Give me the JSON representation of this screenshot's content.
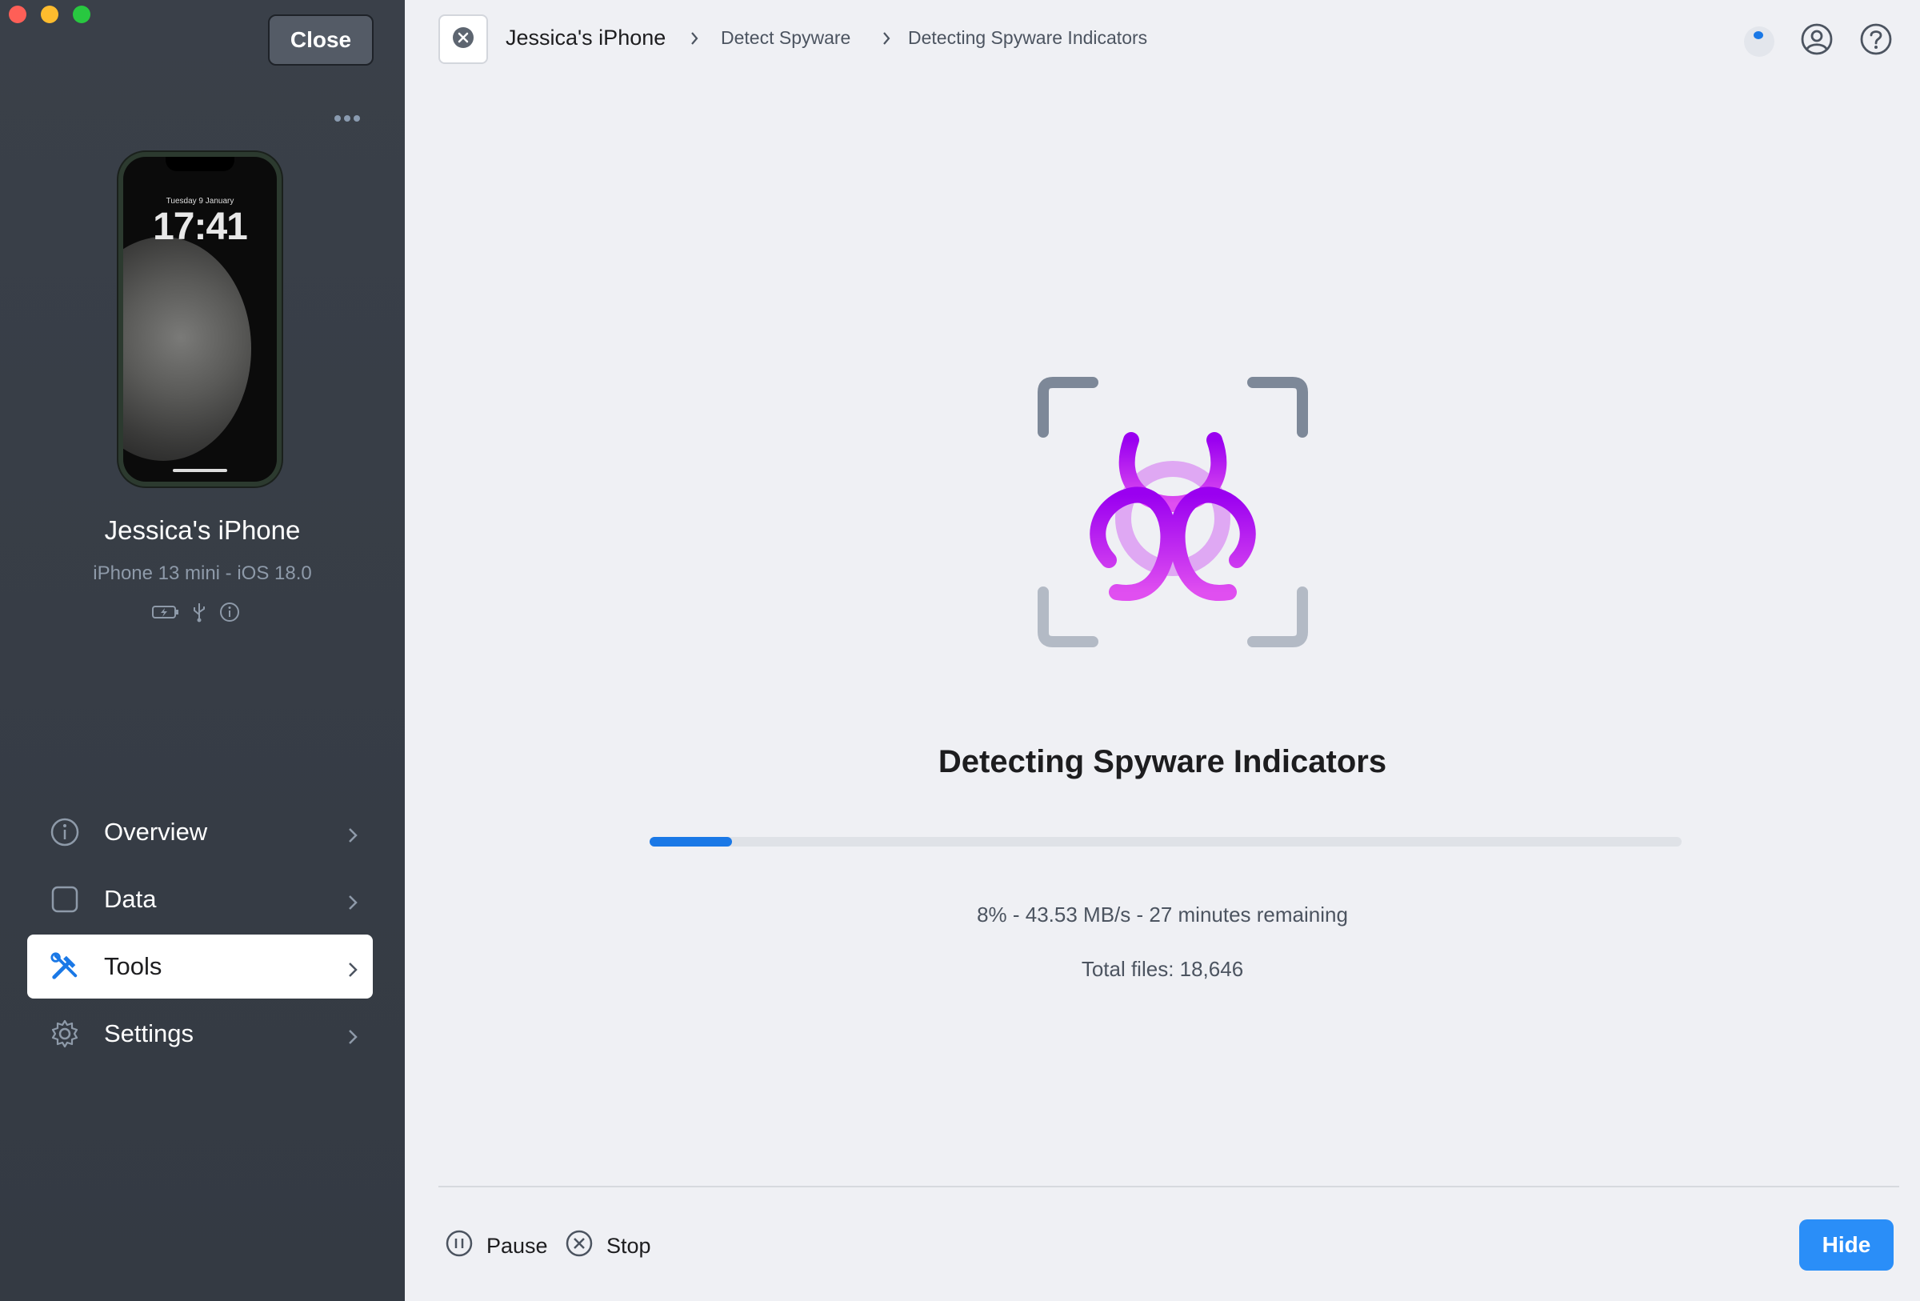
{
  "window": {
    "close_label": "Close"
  },
  "device": {
    "lock_date": "Tuesday 9 January",
    "lock_time": "17:41",
    "name": "Jessica's iPhone",
    "model": "iPhone 13 mini - iOS 18.0"
  },
  "sidebar": {
    "items": [
      {
        "label": "Overview",
        "icon": "info-icon"
      },
      {
        "label": "Data",
        "icon": "square-icon"
      },
      {
        "label": "Tools",
        "icon": "tools-icon",
        "active": true
      },
      {
        "label": "Settings",
        "icon": "gear-icon"
      }
    ]
  },
  "breadcrumb": {
    "device": "Jessica's iPhone",
    "step1": "Detect Spyware",
    "step2": "Detecting Spyware Indicators"
  },
  "scan": {
    "title": "Detecting Spyware Indicators",
    "progress_percent": 8,
    "status_line": "8% - 43.53 MB/s - 27 minutes remaining",
    "total_files": "Total files: 18,646"
  },
  "footer": {
    "pause_label": "Pause",
    "stop_label": "Stop",
    "hide_label": "Hide"
  },
  "colors": {
    "accent": "#1a78e6",
    "button_blue": "#2a8ef8",
    "sidebar_bg": "#3a4049",
    "biohazard_purple": "#b620f0"
  }
}
